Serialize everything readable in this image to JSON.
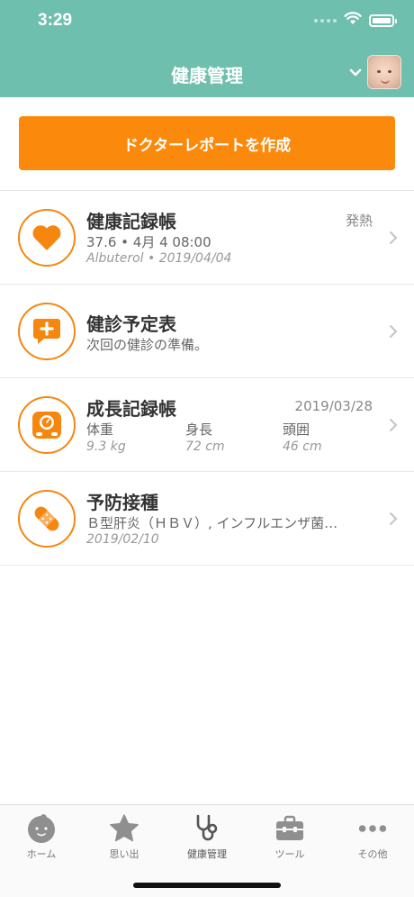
{
  "status_bar": {
    "time": "3:29"
  },
  "nav": {
    "title": "健康管理",
    "profile_dropdown": "chevron-down-icon"
  },
  "report_button": {
    "label": "ドクターレポートを作成"
  },
  "colors": {
    "header": "#6fbfae",
    "accent": "#fb8a0c"
  },
  "items": [
    {
      "title": "健康記録帳",
      "right": "発熱",
      "sub": "37.6 • 4月 4 08:00",
      "meta": "Albuterol • 2019/04/04",
      "icon": "heart-icon"
    },
    {
      "title": "健診予定表",
      "sub": "次回の健診の準備。",
      "icon": "medical-chat-icon"
    },
    {
      "title": "成長記録帳",
      "right": "2019/03/28",
      "icon": "scale-icon",
      "columns": [
        {
          "label": "体重",
          "value": "9.3 kg"
        },
        {
          "label": "身長",
          "value": "72 cm"
        },
        {
          "label": "頭囲",
          "value": "46 cm"
        }
      ]
    },
    {
      "title": "予防接種",
      "sub": "Ｂ型肝炎（ＨＢＶ）, インフルエンザ菌…",
      "meta": "2019/02/10",
      "icon": "bandage-icon"
    }
  ],
  "tabs": [
    {
      "label": "ホーム",
      "icon": "baby-face-icon"
    },
    {
      "label": "思い出",
      "icon": "star-icon"
    },
    {
      "label": "健康管理",
      "icon": "stethoscope-icon",
      "active": true
    },
    {
      "label": "ツール",
      "icon": "toolbox-icon"
    },
    {
      "label": "その他",
      "icon": "more-icon"
    }
  ]
}
